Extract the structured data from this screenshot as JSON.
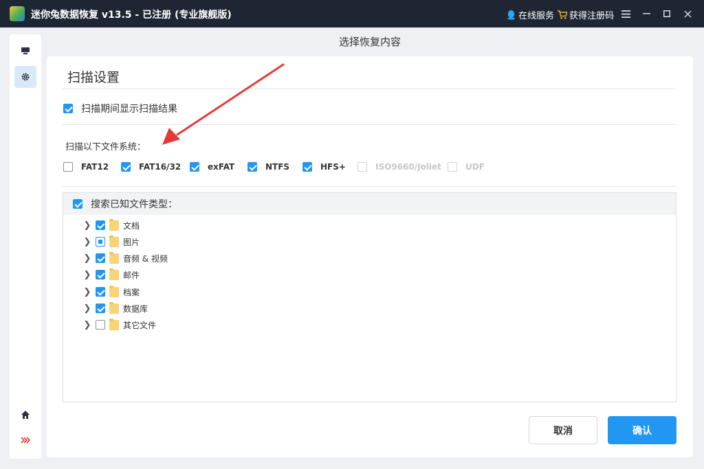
{
  "app": {
    "title": "迷你兔数据恢复 v13.5 - 已注册 (专业旗舰版)",
    "online_service": "在线服务",
    "get_code": "获得注册码"
  },
  "header": {
    "title": "选择恢复内容"
  },
  "settings": {
    "section_title": "扫描设置",
    "show_results_label": "扫描期间显示扫描结果",
    "show_results_checked": true,
    "fs_label": "扫描以下文件系统：",
    "filesystems": [
      {
        "name": "FAT12",
        "checked": false,
        "enabled": true
      },
      {
        "name": "FAT16/32",
        "checked": true,
        "enabled": true
      },
      {
        "name": "exFAT",
        "checked": true,
        "enabled": true
      },
      {
        "name": "NTFS",
        "checked": true,
        "enabled": true
      },
      {
        "name": "HFS+",
        "checked": true,
        "enabled": true
      },
      {
        "name": "ISO9660/Joliet",
        "checked": false,
        "enabled": false
      },
      {
        "name": "UDF",
        "checked": false,
        "enabled": false
      }
    ]
  },
  "tree": {
    "header_label": "搜索已知文件类型：",
    "header_checked": true,
    "items": [
      {
        "label": "文档",
        "state": "checked"
      },
      {
        "label": "图片",
        "state": "partial"
      },
      {
        "label": "音频 & 视频",
        "state": "checked"
      },
      {
        "label": "邮件",
        "state": "checked"
      },
      {
        "label": "档案",
        "state": "checked"
      },
      {
        "label": "数据库",
        "state": "checked"
      },
      {
        "label": "其它文件",
        "state": "unchecked"
      }
    ]
  },
  "buttons": {
    "cancel": "取消",
    "confirm": "确认"
  },
  "colors": {
    "titlebar": "#1f2633",
    "accent": "#2196f3",
    "annotation": "#e53935"
  }
}
